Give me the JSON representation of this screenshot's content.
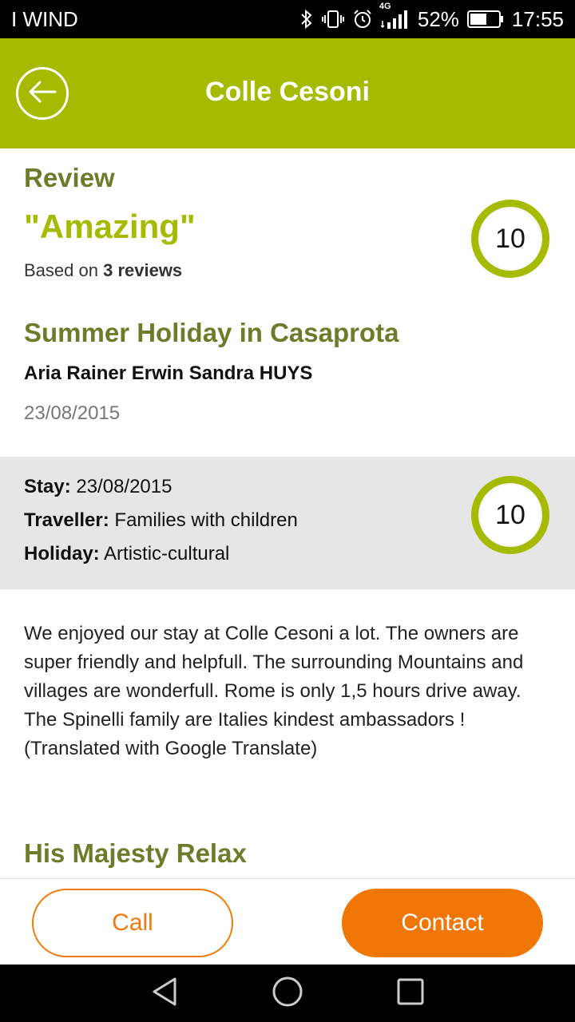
{
  "status_bar": {
    "carrier": "I WIND",
    "network": "4G",
    "battery": "52%",
    "time": "17:55"
  },
  "header": {
    "title": "Colle Cesoni"
  },
  "summary": {
    "heading": "Review",
    "title": "\"Amazing\"",
    "based_prefix": "Based on",
    "based_count": "3 reviews",
    "score": "10"
  },
  "review": {
    "title": "Summer Holiday in Casaprota",
    "author": "Aria Rainer Erwin Sandra HUYS",
    "date": "23/08/2015",
    "score": "10",
    "meta": {
      "stay_label": "Stay:",
      "stay_value": "23/08/2015",
      "traveller_label": "Traveller:",
      "traveller_value": "Families with children",
      "holiday_label": "Holiday:",
      "holiday_value": "Artistic-cultural"
    },
    "text": "We enjoyed our stay at Colle Cesoni a lot. The owners are super friendly and helpfull. The surrounding Mountains and villages are wonderfull. Rome is only 1,5 hours drive away. The Spinelli family are Italies kindest ambassadors !",
    "translated_note": "(Translated with Google Translate)"
  },
  "next_review": {
    "title": "His Majesty Relax"
  },
  "actions": {
    "call_label": "Call",
    "contact_label": "Contact"
  },
  "colors": {
    "accent_green": "#a6ba00",
    "title_green": "#6b7d2a",
    "accent_orange": "#f07605"
  }
}
